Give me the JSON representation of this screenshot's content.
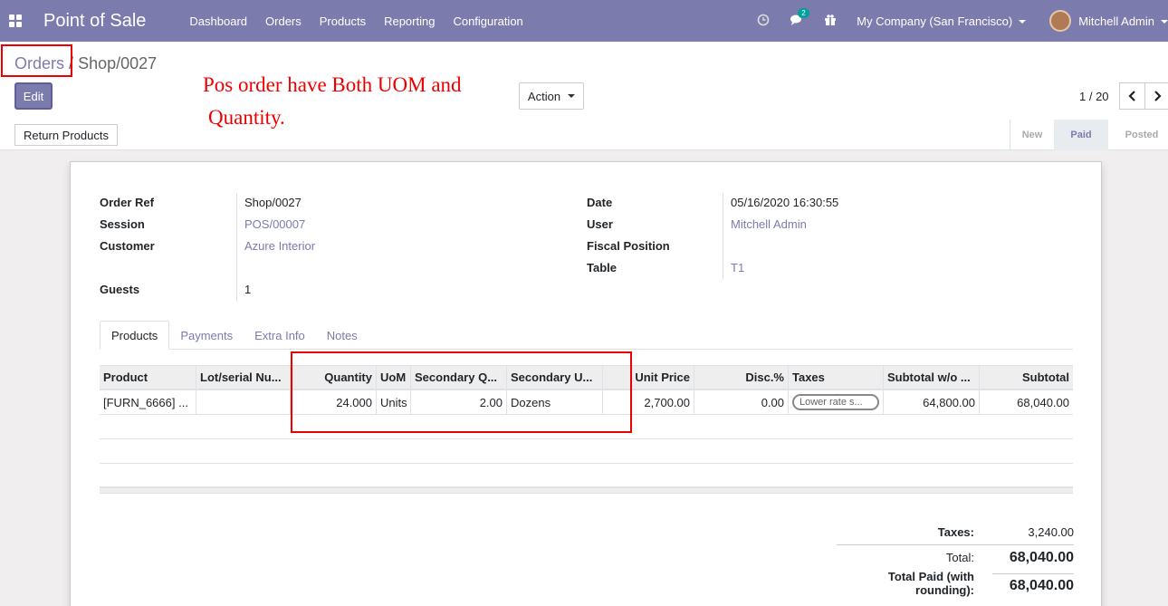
{
  "app": {
    "title": "Point of Sale",
    "menu": [
      "Dashboard",
      "Orders",
      "Products",
      "Reporting",
      "Configuration"
    ],
    "chat_count": "2",
    "company": "My Company (San Francisco)",
    "user": "Mitchell Admin"
  },
  "breadcrumb": {
    "parent": "Orders",
    "separator": "/",
    "current": "Shop/0027"
  },
  "annotation": {
    "line1": "Pos order have Both UOM and",
    "line2": "Quantity."
  },
  "buttons": {
    "edit": "Edit",
    "action": "Action",
    "return_products": "Return Products"
  },
  "pager": {
    "value": "1 / 20"
  },
  "status": {
    "new": "New",
    "paid": "Paid",
    "posted": "Posted"
  },
  "form": {
    "order_ref_label": "Order Ref",
    "order_ref": "Shop/0027",
    "session_label": "Session",
    "session": "POS/00007",
    "customer_label": "Customer",
    "customer": "Azure Interior",
    "guests_label": "Guests",
    "guests": "1",
    "date_label": "Date",
    "date": "05/16/2020 16:30:55",
    "user_label": "User",
    "user": "Mitchell Admin",
    "fiscal_position_label": "Fiscal Position",
    "table_label": "Table",
    "table": "T1"
  },
  "tabs": [
    "Products",
    "Payments",
    "Extra Info",
    "Notes"
  ],
  "lines": {
    "headers": [
      "Product",
      "Lot/serial Nu...",
      "Quantity",
      "UoM",
      "Secondary Q...",
      "Secondary U...",
      "Unit Price",
      "Disc.%",
      "Taxes",
      "Subtotal w/o ...",
      "Subtotal"
    ],
    "rows": [
      {
        "product": "[FURN_6666] ...",
        "lot": "",
        "quantity": "24.000",
        "uom": "Units",
        "secondary_qty": "2.00",
        "secondary_uom": "Dozens",
        "unit_price": "2,700.00",
        "discount": "0.00",
        "taxes": "Lower rate s...",
        "subtotal_wo": "64,800.00",
        "subtotal": "68,040.00"
      }
    ]
  },
  "totals": {
    "taxes_label": "Taxes:",
    "taxes": "3,240.00",
    "total_label": "Total:",
    "total": "68,040.00",
    "paid_label": "Total Paid (with rounding):",
    "paid": "68,040.00"
  }
}
